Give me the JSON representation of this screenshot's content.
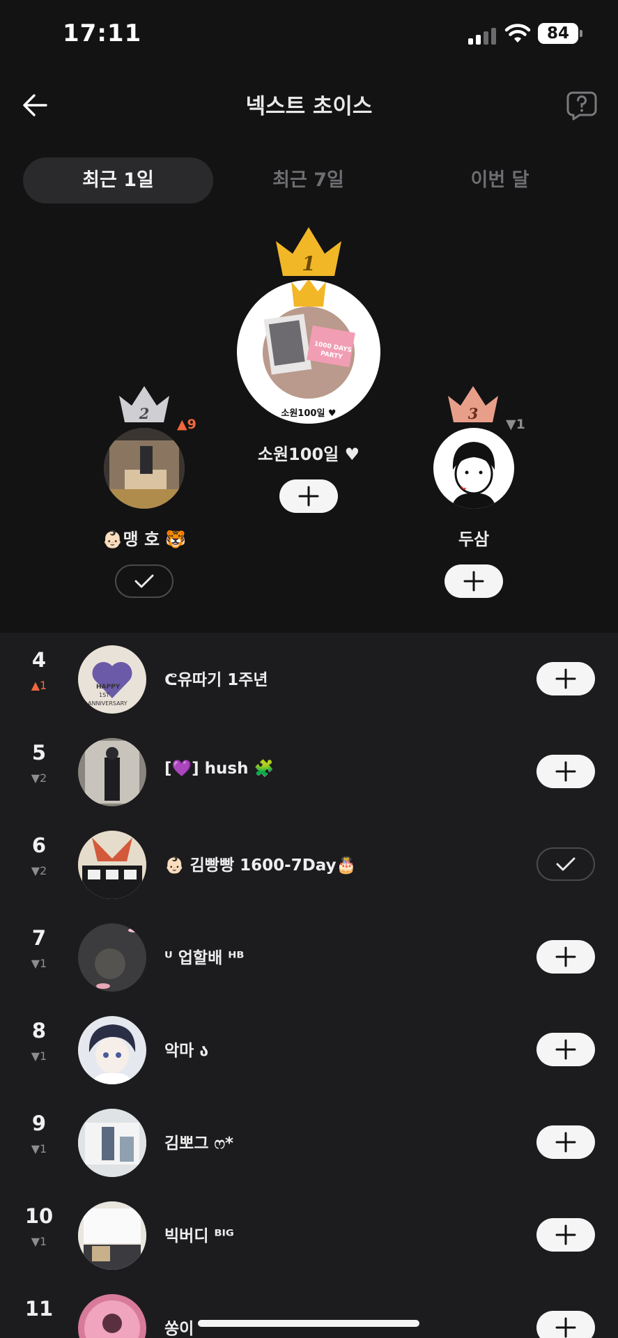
{
  "status_bar": {
    "time": "17:11",
    "battery": "84"
  },
  "header": {
    "title": "넥스트 초이스"
  },
  "tabs": [
    {
      "label": "최근 1일",
      "active": true
    },
    {
      "label": "최근 7일",
      "active": false
    },
    {
      "label": "이번 달",
      "active": false
    }
  ],
  "podium": {
    "first": {
      "rank": "1",
      "name": "소원100일 ♥",
      "avatar_caption": "소원100일 ♥",
      "followed": false
    },
    "second": {
      "rank": "2",
      "name": "👶🏻맹 호 🐯",
      "change": "▲9",
      "followed": true
    },
    "third": {
      "rank": "3",
      "name": "두삼",
      "change": "▼1",
      "followed": false
    }
  },
  "list": [
    {
      "rank": "4",
      "change": "▲1",
      "dir": "up",
      "name": "ᕦ유따기 1주년",
      "followed": false,
      "avatar_color": "#e9e2d8"
    },
    {
      "rank": "5",
      "change": "▼2",
      "dir": "down",
      "name": "[💜] hush 🧩",
      "followed": false,
      "avatar_color": "#8a857e"
    },
    {
      "rank": "6",
      "change": "▼2",
      "dir": "down",
      "name": "👶🏻 김빵빵 1600-7Day🎂",
      "followed": true,
      "avatar_color": "#b08a5a"
    },
    {
      "rank": "7",
      "change": "▼1",
      "dir": "down",
      "name": "ᵁ 업할배 ᴴᴮ",
      "followed": false,
      "avatar_color": "#3c3b3d"
    },
    {
      "rank": "8",
      "change": "▼1",
      "dir": "down",
      "name": "악마 ა",
      "followed": false,
      "avatar_color": "#e6e8ef"
    },
    {
      "rank": "9",
      "change": "▼1",
      "dir": "down",
      "name": "김뽀그 ෆ*",
      "followed": false,
      "avatar_color": "#b7c3cf"
    },
    {
      "rank": "10",
      "change": "▼1",
      "dir": "down",
      "name": "빅버디 ᴮᴵᴳ",
      "followed": false,
      "avatar_color": "#d9d4cc"
    },
    {
      "rank": "11",
      "change": "",
      "dir": "down",
      "name": "쏭이",
      "followed": false,
      "avatar_color": "#d87a9a"
    }
  ]
}
